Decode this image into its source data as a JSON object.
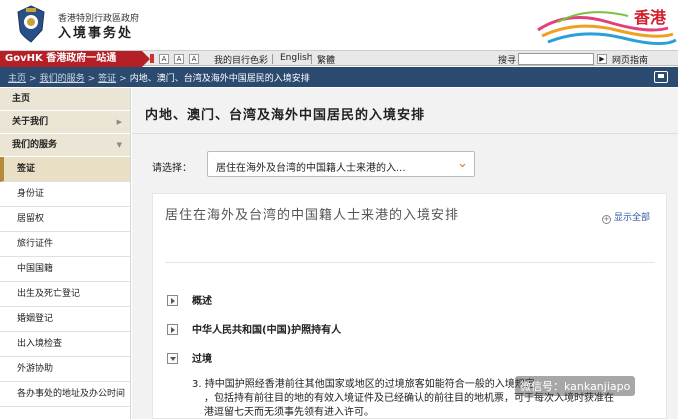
{
  "header": {
    "dept_line1": "香港特別行政區政府",
    "dept_name": "入境事务处",
    "brand": "香港"
  },
  "govbar": {
    "title": "GovHK 香港政府一站通",
    "font_buttons": [
      "A",
      "A",
      "A"
    ],
    "color_link": "我的目行色彩",
    "lang_en": "English",
    "lang_tc": "繁體",
    "search_label": "搜寻",
    "search_value": "",
    "sitemap": "网页指南"
  },
  "breadcrumb": {
    "items": [
      "主页",
      "我们的服务",
      "签证"
    ],
    "current": "内地、澳门、台湾及海外中国居民的入境安排"
  },
  "sidebar": {
    "top": [
      {
        "label": "主页",
        "chevron": ""
      },
      {
        "label": "关于我们",
        "chevron": "▶"
      },
      {
        "label": "我们的服务",
        "chevron": "▼"
      }
    ],
    "sub": [
      {
        "label": "签证",
        "active": true
      },
      {
        "label": "身份证"
      },
      {
        "label": "居留权"
      },
      {
        "label": "旅行证件"
      },
      {
        "label": "中国国籍"
      },
      {
        "label": "出生及死亡登记"
      },
      {
        "label": "婚姻登记"
      },
      {
        "label": "出入境检查"
      },
      {
        "label": "外游协助"
      },
      {
        "label": "各办事处的地址及办公时间"
      }
    ]
  },
  "main": {
    "page_title": "内地、澳门、台湾及海外中国居民的入境安排",
    "select_label": "请选择：",
    "select_value": "居住在海外及台湾的中国籍人士来港的入...",
    "content_title": "居住在海外及台湾的中国籍人士来港的入境安排",
    "expand_all": "显示全部",
    "sections": [
      {
        "label": "概述",
        "state": "collapsed"
      },
      {
        "label": "中华人民共和国(中国)护照持有人",
        "state": "collapsed"
      },
      {
        "label": "过境",
        "state": "expanded"
      }
    ],
    "body_lines": [
      "3. 持中国护照经香港前往其他国家或地区的过境旅客如能符合一般的入境规定",
      "，包括持有前往目的地的有效入境证件及已经确认的前往目的地机票，可于每次入境时获准在港逗留七天而无须事先领有进入许可。"
    ]
  },
  "watermark": "微信号：kankanjiapo"
}
